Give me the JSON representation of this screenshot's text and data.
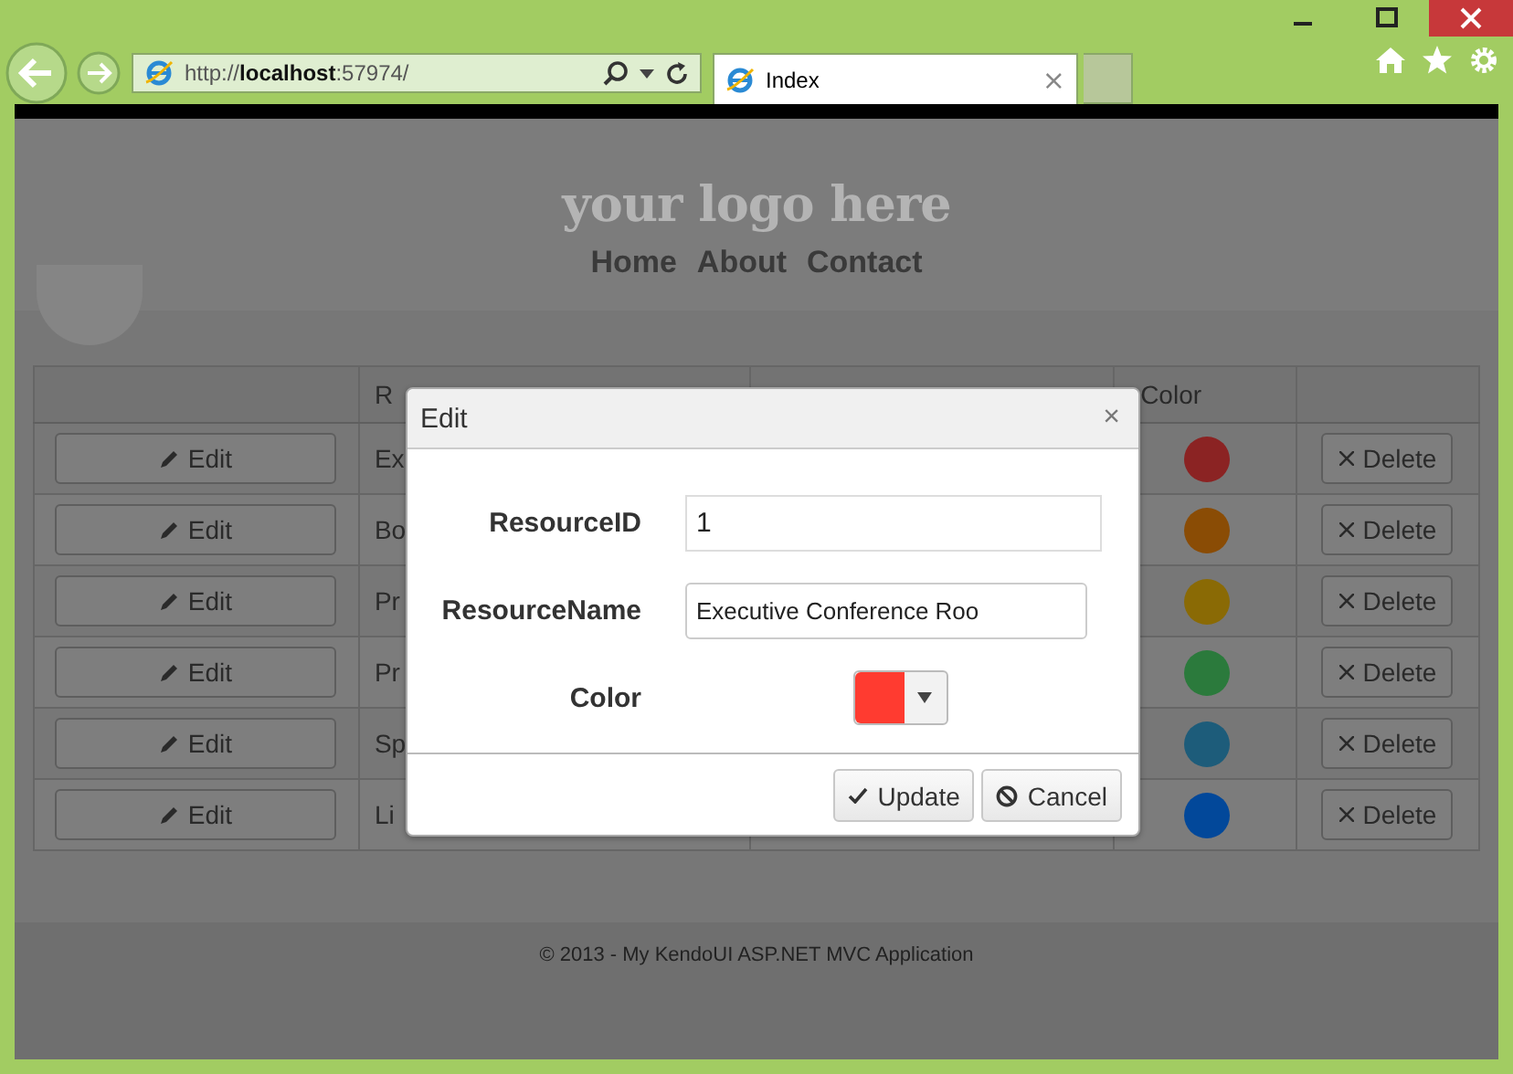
{
  "browser": {
    "url": "http://**localhost**:57974/",
    "tab_title": "Index",
    "tab_close": "×"
  },
  "header": {
    "logo": "your logo here",
    "nav": [
      "Home",
      "About",
      "Contact"
    ]
  },
  "table": {
    "column_2": "R",
    "color_column": "Color",
    "rows": [
      {
        "edit": "Edit",
        "name": "Ex",
        "color": "#8b2323",
        "delete": "Delete"
      },
      {
        "edit": "Edit",
        "name": "Bo",
        "color": "#8a4c05",
        "delete": "Delete"
      },
      {
        "edit": "Edit",
        "name": "Pr",
        "color": "#8a6a05",
        "delete": "Delete"
      },
      {
        "edit": "Edit",
        "name": "Pr",
        "color": "#2b7a3c",
        "delete": "Delete"
      },
      {
        "edit": "Edit",
        "name": "Sp",
        "color": "#1d5c7a",
        "delete": "Delete"
      },
      {
        "edit": "Edit",
        "name": "Li",
        "color": "#02489a",
        "delete": "Delete"
      }
    ]
  },
  "dialog": {
    "title": "Edit",
    "close": "×",
    "fields": [
      {
        "kind": "text",
        "label": "ResourceID",
        "value": "1"
      },
      {
        "kind": "text",
        "label": "ResourceName",
        "value": "Executive Conference Roo"
      },
      {
        "kind": "color",
        "label": "Color",
        "color": "#ff3b30"
      }
    ],
    "buttons": [
      {
        "kind": "update",
        "label": "Update"
      },
      {
        "kind": "cancel",
        "label": "Cancel"
      }
    ]
  },
  "footer": "© 2013 - My KendoUI ASP.NET MVC Application"
}
